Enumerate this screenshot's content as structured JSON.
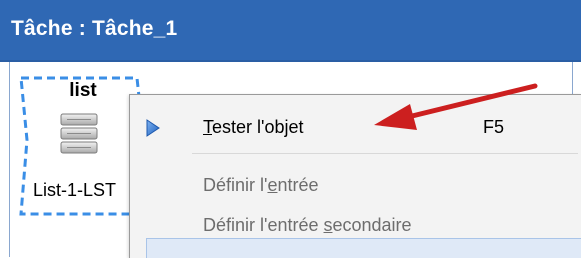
{
  "window": {
    "title": "Tâche : Tâche_1",
    "accent_color": "#2f68b4"
  },
  "node": {
    "type_label": "list",
    "name": "List-1-LST",
    "icon": "list-stack-icon",
    "selection_color": "#3a8ee6"
  },
  "context_menu": {
    "items": [
      {
        "label_pre": "",
        "label_accel": "T",
        "label_post": "ester l'objet",
        "shortcut": "F5",
        "enabled": true,
        "icon": "play-arrow-icon"
      },
      {
        "label_pre": "Définir l'",
        "label_accel": "e",
        "label_post": "ntrée",
        "shortcut": "",
        "enabled": false
      },
      {
        "label_pre": "Définir l'entrée ",
        "label_accel": "s",
        "label_post": "econdaire",
        "shortcut": "",
        "enabled": false
      }
    ]
  },
  "annotation": {
    "icon": "red-pointer-arrow-icon",
    "color": "#cc1f1f"
  }
}
